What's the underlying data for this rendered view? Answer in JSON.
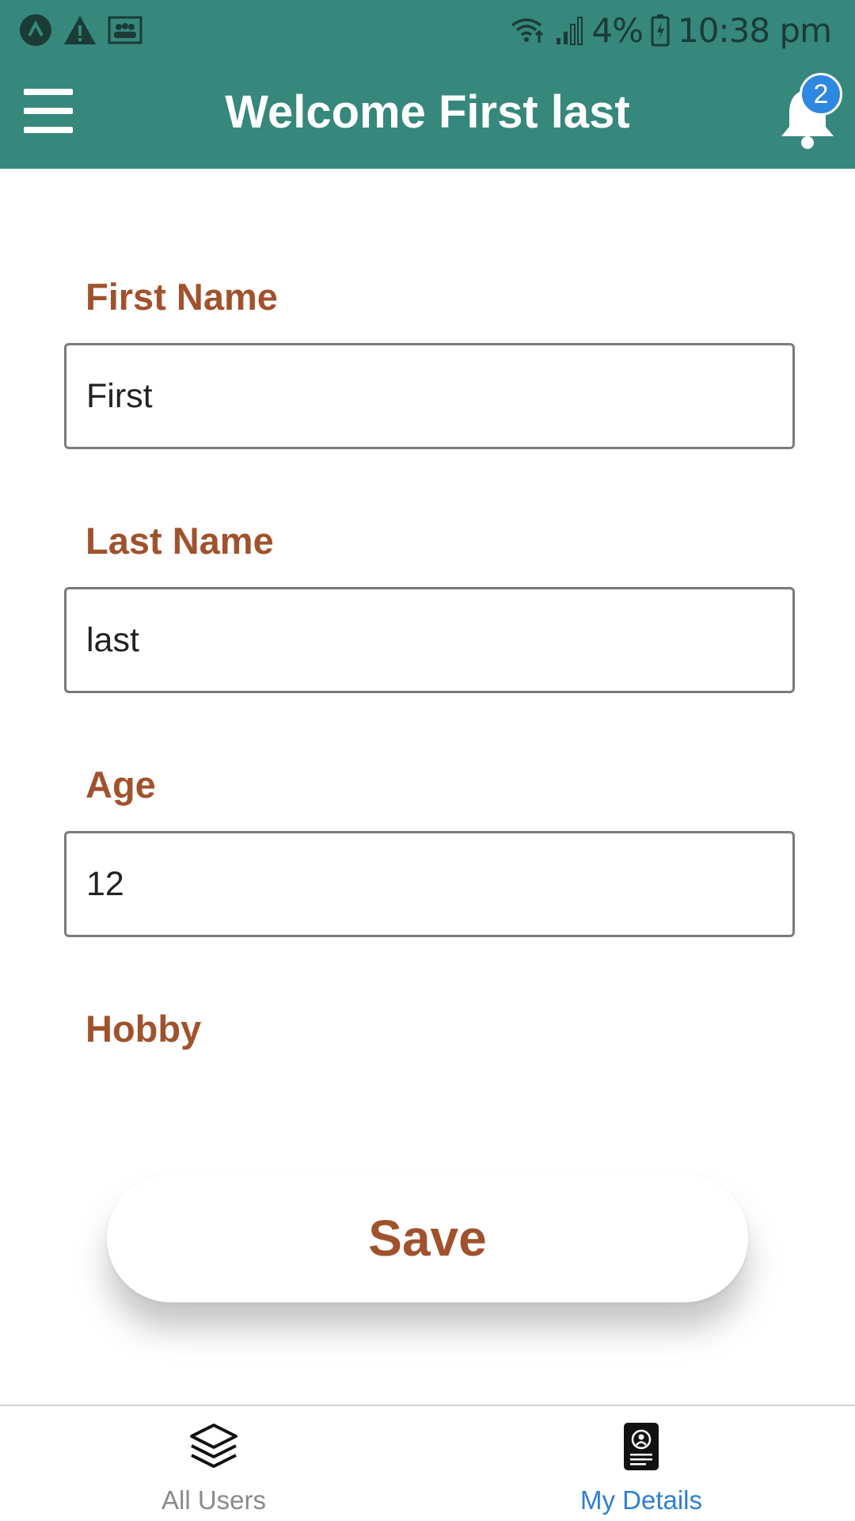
{
  "status_bar": {
    "battery": "4%",
    "time": "10:38 pm"
  },
  "app_bar": {
    "title": "Welcome First last",
    "notification_count": "2"
  },
  "form": {
    "first_name": {
      "label": "First Name",
      "value": "First"
    },
    "last_name": {
      "label": "Last Name",
      "value": "last"
    },
    "age": {
      "label": "Age",
      "value": "12"
    },
    "hobby": {
      "label": "Hobby"
    }
  },
  "save_button": {
    "label": "Save"
  },
  "bottom_nav": {
    "items": [
      {
        "label": "All Users",
        "icon": "layers-icon",
        "active": false
      },
      {
        "label": "My Details",
        "icon": "id-card-icon",
        "active": true
      }
    ]
  },
  "colors": {
    "primary": "#36877c",
    "label": "#a0522d",
    "badge": "#2e87e0",
    "active_nav": "#2e7fd0"
  }
}
